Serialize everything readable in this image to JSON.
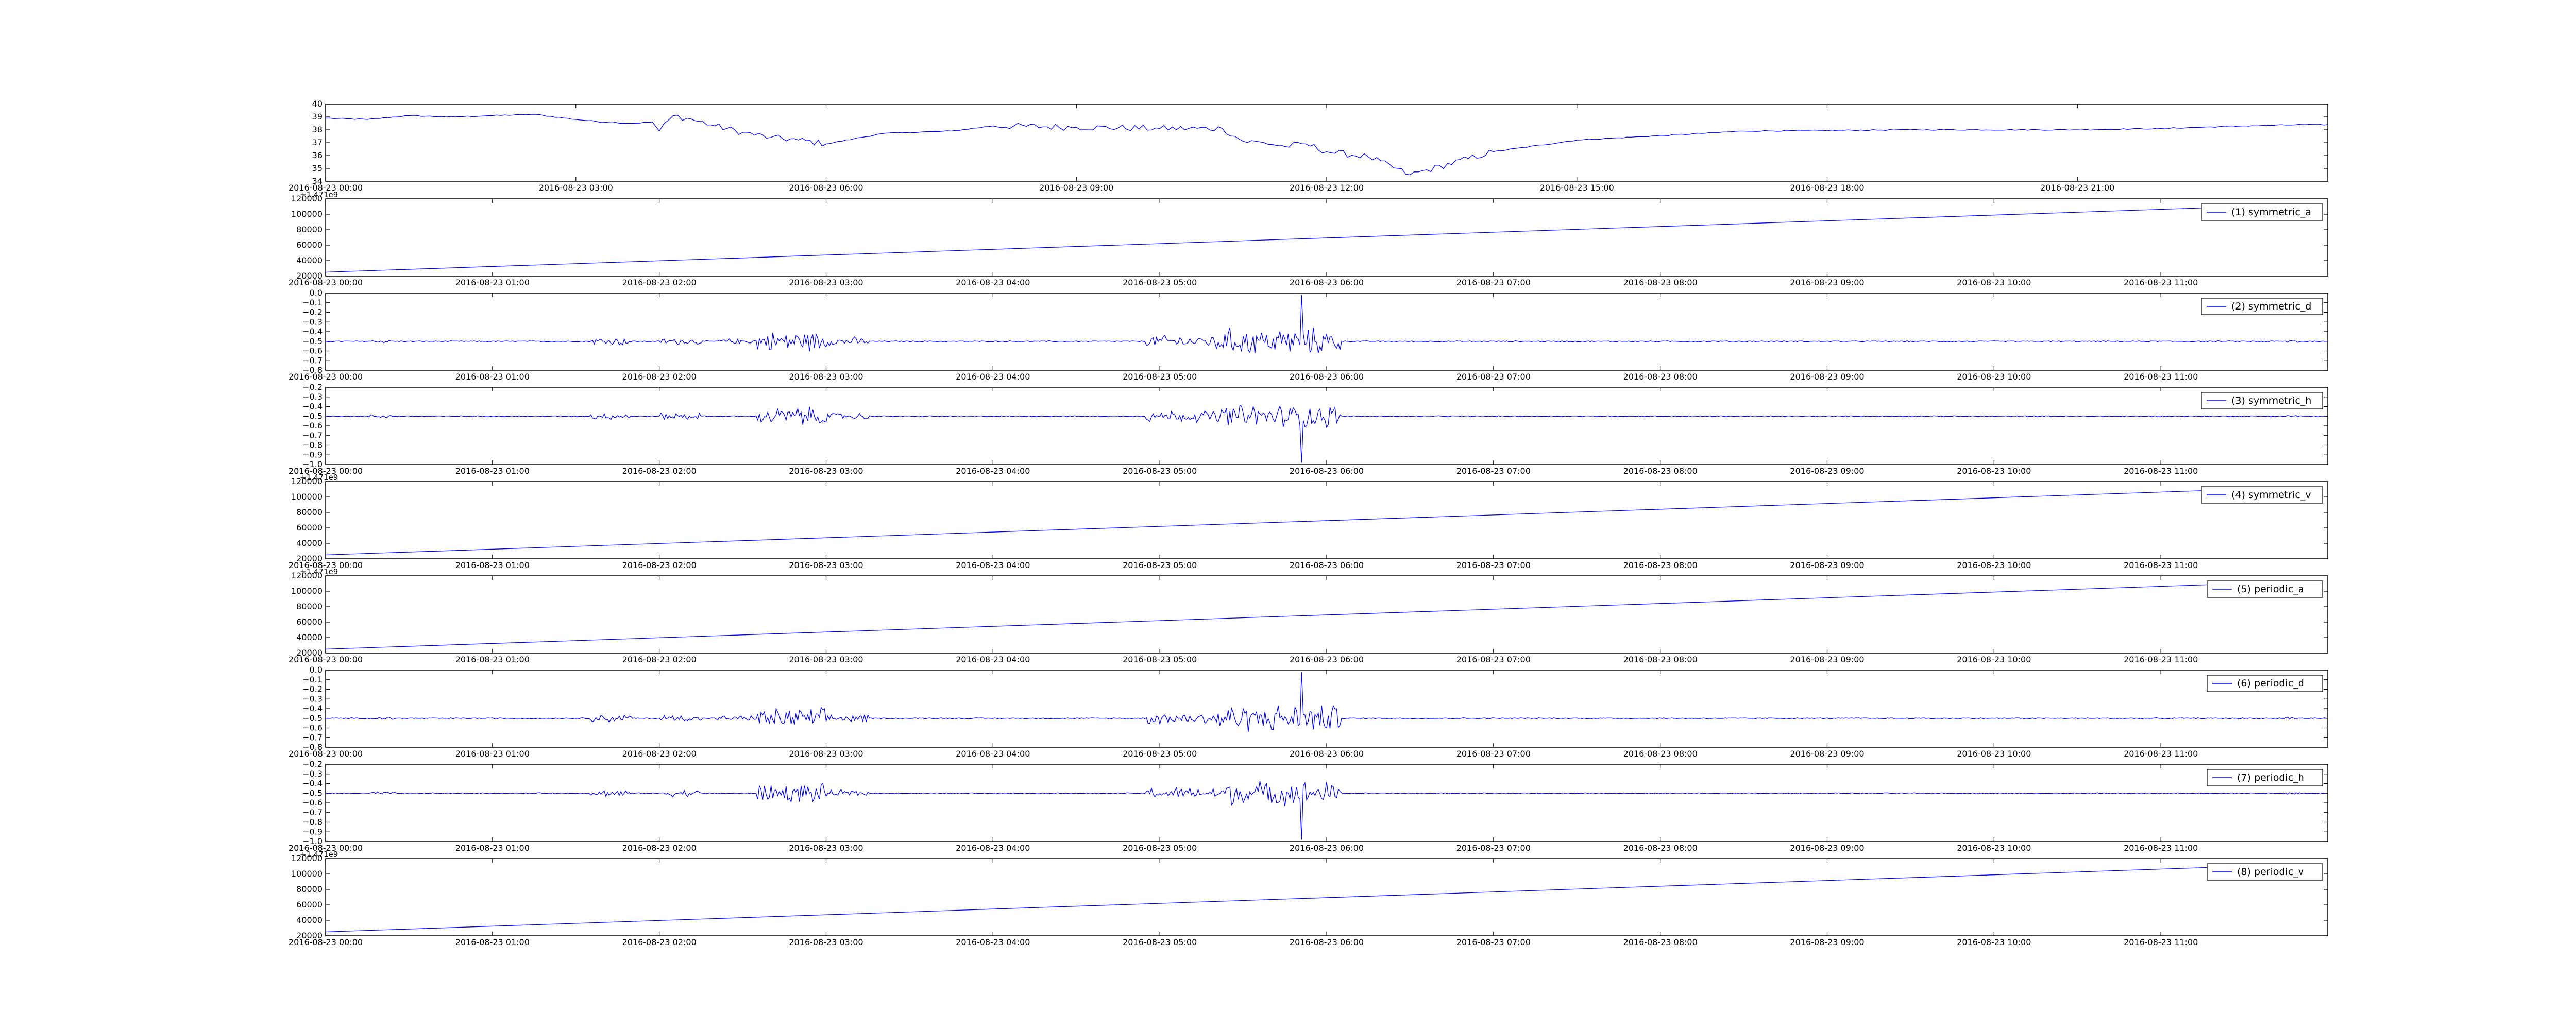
{
  "chart_data": [
    {
      "type": "line",
      "legend": null,
      "x_unit": "datetime",
      "xlim": [
        "2016-08-23 00:00",
        "2016-08-24 00:00"
      ],
      "x_tick_labels": [
        "2016-08-23 00:00",
        "2016-08-23 03:00",
        "2016-08-23 06:00",
        "2016-08-23 09:00",
        "2016-08-23 12:00",
        "2016-08-23 15:00",
        "2016-08-23 18:00",
        "2016-08-23 21:00"
      ],
      "ylim": [
        34,
        40
      ],
      "y_tick_labels": [
        "34",
        "35",
        "36",
        "37",
        "38",
        "39",
        "40"
      ],
      "y_offset_label": "",
      "series": [
        {
          "color": "#0000ff",
          "x": [
            "00:00",
            "00:30",
            "01:00",
            "01:30",
            "02:00",
            "02:30",
            "03:00",
            "03:20",
            "03:40",
            "03:55",
            "04:00",
            "04:10",
            "04:20",
            "04:40",
            "05:00",
            "05:20",
            "05:40",
            "06:00",
            "06:20",
            "06:40",
            "07:00",
            "07:30",
            "08:00",
            "09:00",
            "10:00",
            "10:45",
            "11:00",
            "11:15",
            "11:30",
            "11:45",
            "12:00",
            "12:30",
            "13:00",
            "14:00",
            "15:00",
            "17:00",
            "19:00",
            "21:00",
            "22:00",
            "23:00",
            "23:45",
            "24:00"
          ],
          "y": [
            38.9,
            38.8,
            39.1,
            39.0,
            39.1,
            39.2,
            38.8,
            38.6,
            38.5,
            38.6,
            37.9,
            39.1,
            38.9,
            38.3,
            37.8,
            37.4,
            37.2,
            36.9,
            37.3,
            37.7,
            37.8,
            37.9,
            38.3,
            38.2,
            38.1,
            38.1,
            37.1,
            37.0,
            36.7,
            36.9,
            36.3,
            35.9,
            34.5,
            36.3,
            37.2,
            37.9,
            38.0,
            38.0,
            38.1,
            38.3,
            38.4,
            38.4
          ]
        }
      ]
    },
    {
      "type": "line",
      "legend": "(1) symmetric_a",
      "x_unit": "datetime",
      "xlim": [
        "2016-08-23 00:00",
        "2016-08-23 12:00"
      ],
      "x_tick_labels": [
        "2016-08-23 00:00",
        "2016-08-23 01:00",
        "2016-08-23 02:00",
        "2016-08-23 03:00",
        "2016-08-23 04:00",
        "2016-08-23 05:00",
        "2016-08-23 06:00",
        "2016-08-23 07:00",
        "2016-08-23 08:00",
        "2016-08-23 09:00",
        "2016-08-23 10:00",
        "2016-08-23 11:00"
      ],
      "ylim": [
        20000,
        120000
      ],
      "y_tick_labels": [
        "20000",
        "40000",
        "60000",
        "80000",
        "100000",
        "120000"
      ],
      "y_offset_label": "+1.471e9",
      "series": [
        {
          "color": "#0000ff",
          "x": [
            "00:00",
            "11:30"
          ],
          "y": [
            25000,
            110000
          ]
        }
      ]
    },
    {
      "type": "line",
      "legend": "(2) symmetric_d",
      "x_unit": "datetime",
      "xlim": [
        "2016-08-23 00:00",
        "2016-08-23 12:00"
      ],
      "x_tick_labels": [
        "2016-08-23 00:00",
        "2016-08-23 01:00",
        "2016-08-23 02:00",
        "2016-08-23 03:00",
        "2016-08-23 04:00",
        "2016-08-23 05:00",
        "2016-08-23 06:00",
        "2016-08-23 07:00",
        "2016-08-23 08:00",
        "2016-08-23 09:00",
        "2016-08-23 10:00",
        "2016-08-23 11:00"
      ],
      "ylim": [
        -0.8,
        0.0
      ],
      "y_tick_labels": [
        "−0.8",
        "−0.7",
        "−0.6",
        "−0.5",
        "−0.4",
        "−0.3",
        "−0.2",
        "−0.1",
        "0.0"
      ],
      "y_offset_label": "",
      "series": [
        {
          "color": "#0000ff",
          "baseline": -0.5,
          "spike_x": [
            "05:51"
          ],
          "spike_y": [
            -0.02
          ],
          "noise_bands": [
            {
              "start": "00:00",
              "end": "11:59",
              "amplitude": 0.006
            },
            {
              "start": "00:15",
              "end": "00:25",
              "amplitude": 0.02
            },
            {
              "start": "01:35",
              "end": "01:50",
              "amplitude": 0.05
            },
            {
              "start": "02:00",
              "end": "02:15",
              "amplitude": 0.04
            },
            {
              "start": "02:20",
              "end": "02:35",
              "amplitude": 0.03
            },
            {
              "start": "02:35",
              "end": "03:00",
              "amplitude": 0.12
            },
            {
              "start": "03:00",
              "end": "03:15",
              "amplitude": 0.05
            },
            {
              "start": "04:55",
              "end": "05:20",
              "amplitude": 0.07
            },
            {
              "start": "05:20",
              "end": "06:05",
              "amplitude": 0.16
            },
            {
              "start": "11:45",
              "end": "11:50",
              "amplitude": 0.02
            }
          ]
        }
      ]
    },
    {
      "type": "line",
      "legend": "(3) symmetric_h",
      "x_unit": "datetime",
      "xlim": [
        "2016-08-23 00:00",
        "2016-08-23 12:00"
      ],
      "x_tick_labels": [
        "2016-08-23 00:00",
        "2016-08-23 01:00",
        "2016-08-23 02:00",
        "2016-08-23 03:00",
        "2016-08-23 04:00",
        "2016-08-23 05:00",
        "2016-08-23 06:00",
        "2016-08-23 07:00",
        "2016-08-23 08:00",
        "2016-08-23 09:00",
        "2016-08-23 10:00",
        "2016-08-23 11:00"
      ],
      "ylim": [
        -1.0,
        -0.2
      ],
      "y_tick_labels": [
        "−1.0",
        "−0.9",
        "−0.8",
        "−0.7",
        "−0.6",
        "−0.5",
        "−0.4",
        "−0.3",
        "−0.2"
      ],
      "y_offset_label": "",
      "series": [
        {
          "color": "#0000ff",
          "baseline": -0.5,
          "spike_x": [
            "05:51"
          ],
          "spike_y": [
            -0.98
          ],
          "noise_bands": [
            {
              "start": "00:00",
              "end": "11:59",
              "amplitude": 0.006
            },
            {
              "start": "00:15",
              "end": "00:25",
              "amplitude": 0.02
            },
            {
              "start": "01:35",
              "end": "01:50",
              "amplitude": 0.04
            },
            {
              "start": "02:00",
              "end": "02:15",
              "amplitude": 0.04
            },
            {
              "start": "02:35",
              "end": "03:00",
              "amplitude": 0.11
            },
            {
              "start": "03:00",
              "end": "03:15",
              "amplitude": 0.04
            },
            {
              "start": "04:55",
              "end": "05:20",
              "amplitude": 0.07
            },
            {
              "start": "05:20",
              "end": "06:05",
              "amplitude": 0.14
            },
            {
              "start": "11:45",
              "end": "11:50",
              "amplitude": 0.02
            }
          ]
        }
      ]
    },
    {
      "type": "line",
      "legend": "(4) symmetric_v",
      "x_unit": "datetime",
      "xlim": [
        "2016-08-23 00:00",
        "2016-08-23 12:00"
      ],
      "x_tick_labels": [
        "2016-08-23 00:00",
        "2016-08-23 01:00",
        "2016-08-23 02:00",
        "2016-08-23 03:00",
        "2016-08-23 04:00",
        "2016-08-23 05:00",
        "2016-08-23 06:00",
        "2016-08-23 07:00",
        "2016-08-23 08:00",
        "2016-08-23 09:00",
        "2016-08-23 10:00",
        "2016-08-23 11:00"
      ],
      "ylim": [
        20000,
        120000
      ],
      "y_tick_labels": [
        "20000",
        "40000",
        "60000",
        "80000",
        "100000",
        "120000"
      ],
      "y_offset_label": "+1.471e9",
      "series": [
        {
          "color": "#0000ff",
          "x": [
            "00:00",
            "11:30"
          ],
          "y": [
            25000,
            110000
          ]
        }
      ]
    },
    {
      "type": "line",
      "legend": "(5) periodic_a",
      "x_unit": "datetime",
      "xlim": [
        "2016-08-23 00:00",
        "2016-08-23 12:00"
      ],
      "x_tick_labels": [
        "2016-08-23 00:00",
        "2016-08-23 01:00",
        "2016-08-23 02:00",
        "2016-08-23 03:00",
        "2016-08-23 04:00",
        "2016-08-23 05:00",
        "2016-08-23 06:00",
        "2016-08-23 07:00",
        "2016-08-23 08:00",
        "2016-08-23 09:00",
        "2016-08-23 10:00",
        "2016-08-23 11:00"
      ],
      "ylim": [
        20000,
        120000
      ],
      "y_tick_labels": [
        "20000",
        "40000",
        "60000",
        "80000",
        "100000",
        "120000"
      ],
      "y_offset_label": "+1.471e9",
      "series": [
        {
          "color": "#0000ff",
          "x": [
            "00:00",
            "11:30"
          ],
          "y": [
            25000,
            110000
          ]
        }
      ]
    },
    {
      "type": "line",
      "legend": "(6) periodic_d",
      "x_unit": "datetime",
      "xlim": [
        "2016-08-23 00:00",
        "2016-08-23 12:00"
      ],
      "x_tick_labels": [
        "2016-08-23 00:00",
        "2016-08-23 01:00",
        "2016-08-23 02:00",
        "2016-08-23 03:00",
        "2016-08-23 04:00",
        "2016-08-23 05:00",
        "2016-08-23 06:00",
        "2016-08-23 07:00",
        "2016-08-23 08:00",
        "2016-08-23 09:00",
        "2016-08-23 10:00",
        "2016-08-23 11:00"
      ],
      "ylim": [
        -0.8,
        0.0
      ],
      "y_tick_labels": [
        "−0.8",
        "−0.7",
        "−0.6",
        "−0.5",
        "−0.4",
        "−0.3",
        "−0.2",
        "−0.1",
        "0.0"
      ],
      "y_offset_label": "",
      "series": [
        {
          "color": "#0000ff",
          "baseline": -0.5,
          "spike_x": [
            "05:51"
          ],
          "spike_y": [
            -0.02
          ],
          "noise_bands": [
            {
              "start": "00:00",
              "end": "11:59",
              "amplitude": 0.006
            },
            {
              "start": "00:15",
              "end": "00:25",
              "amplitude": 0.02
            },
            {
              "start": "01:35",
              "end": "01:50",
              "amplitude": 0.05
            },
            {
              "start": "02:00",
              "end": "02:15",
              "amplitude": 0.04
            },
            {
              "start": "02:20",
              "end": "02:35",
              "amplitude": 0.03
            },
            {
              "start": "02:35",
              "end": "03:00",
              "amplitude": 0.12
            },
            {
              "start": "03:00",
              "end": "03:15",
              "amplitude": 0.05
            },
            {
              "start": "04:55",
              "end": "05:20",
              "amplitude": 0.07
            },
            {
              "start": "05:20",
              "end": "06:05",
              "amplitude": 0.16
            },
            {
              "start": "11:45",
              "end": "11:50",
              "amplitude": 0.02
            }
          ]
        }
      ]
    },
    {
      "type": "line",
      "legend": "(7) periodic_h",
      "x_unit": "datetime",
      "xlim": [
        "2016-08-23 00:00",
        "2016-08-23 12:00"
      ],
      "x_tick_labels": [
        "2016-08-23 00:00",
        "2016-08-23 01:00",
        "2016-08-23 02:00",
        "2016-08-23 03:00",
        "2016-08-23 04:00",
        "2016-08-23 05:00",
        "2016-08-23 06:00",
        "2016-08-23 07:00",
        "2016-08-23 08:00",
        "2016-08-23 09:00",
        "2016-08-23 10:00",
        "2016-08-23 11:00"
      ],
      "ylim": [
        -1.0,
        -0.2
      ],
      "y_tick_labels": [
        "−1.0",
        "−0.9",
        "−0.8",
        "−0.7",
        "−0.6",
        "−0.5",
        "−0.4",
        "−0.3",
        "−0.2"
      ],
      "y_offset_label": "",
      "series": [
        {
          "color": "#0000ff",
          "baseline": -0.5,
          "spike_x": [
            "05:51"
          ],
          "spike_y": [
            -0.98
          ],
          "noise_bands": [
            {
              "start": "00:00",
              "end": "11:59",
              "amplitude": 0.006
            },
            {
              "start": "00:15",
              "end": "00:25",
              "amplitude": 0.02
            },
            {
              "start": "01:35",
              "end": "01:50",
              "amplitude": 0.04
            },
            {
              "start": "02:00",
              "end": "02:15",
              "amplitude": 0.04
            },
            {
              "start": "02:35",
              "end": "03:00",
              "amplitude": 0.11
            },
            {
              "start": "03:00",
              "end": "03:15",
              "amplitude": 0.04
            },
            {
              "start": "04:55",
              "end": "05:20",
              "amplitude": 0.07
            },
            {
              "start": "05:20",
              "end": "06:05",
              "amplitude": 0.14
            },
            {
              "start": "11:45",
              "end": "11:50",
              "amplitude": 0.02
            }
          ]
        }
      ]
    },
    {
      "type": "line",
      "legend": "(8) periodic_v",
      "x_unit": "datetime",
      "xlim": [
        "2016-08-23 00:00",
        "2016-08-23 12:00"
      ],
      "x_tick_labels": [
        "2016-08-23 00:00",
        "2016-08-23 01:00",
        "2016-08-23 02:00",
        "2016-08-23 03:00",
        "2016-08-23 04:00",
        "2016-08-23 05:00",
        "2016-08-23 06:00",
        "2016-08-23 07:00",
        "2016-08-23 08:00",
        "2016-08-23 09:00",
        "2016-08-23 10:00",
        "2016-08-23 11:00"
      ],
      "ylim": [
        20000,
        120000
      ],
      "y_tick_labels": [
        "20000",
        "40000",
        "60000",
        "80000",
        "100000",
        "120000"
      ],
      "y_offset_label": "+1.471e9",
      "series": [
        {
          "color": "#0000ff",
          "x": [
            "00:00",
            "11:30"
          ],
          "y": [
            25000,
            110000
          ]
        }
      ]
    }
  ]
}
